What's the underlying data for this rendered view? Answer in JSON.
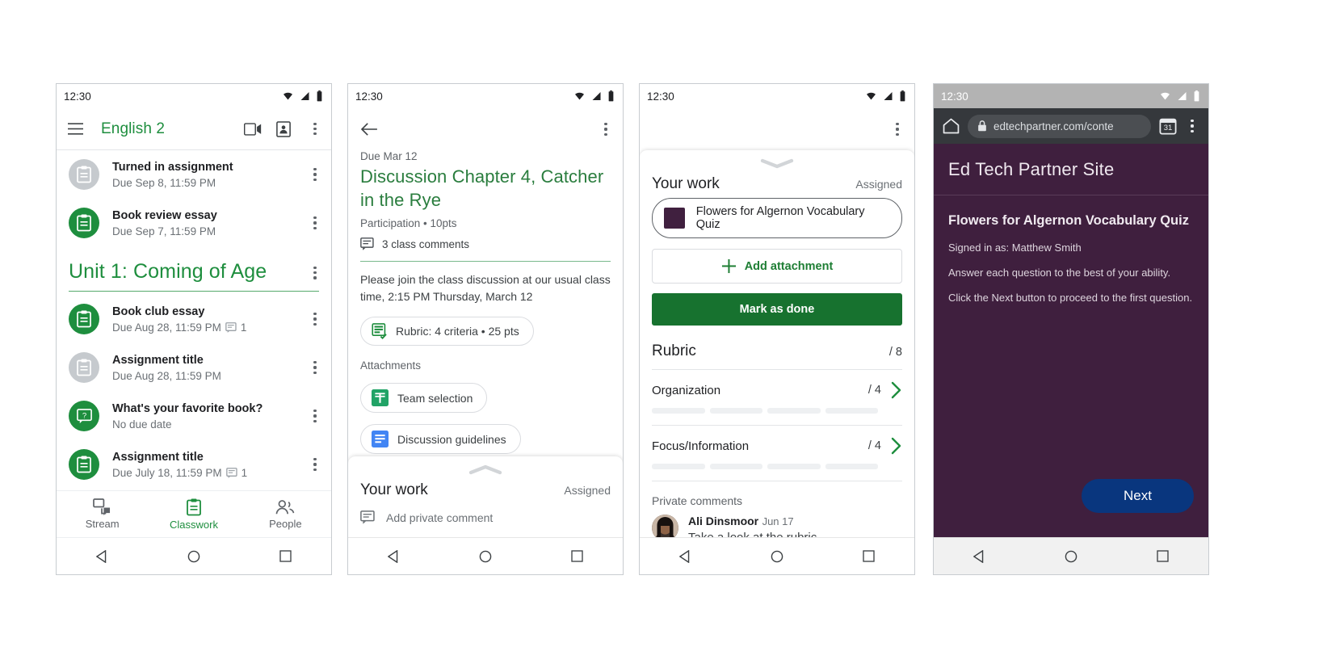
{
  "screen1": {
    "statusbar": {
      "clock": "12:30",
      "icons": [
        "wifi-icon",
        "signal-icon",
        "battery-icon"
      ]
    },
    "appbar": {
      "menu_icon": "hamburger-menu-icon",
      "title": "English 2",
      "actions": [
        "video-call-icon",
        "class-card-icon",
        "overflow-menu-icon"
      ]
    },
    "top_items": [
      {
        "title": "Turned in assignment",
        "subtitle": "Due Sep 8, 11:59 PM",
        "icon": "assignment-icon",
        "state": "grey",
        "comments": ""
      },
      {
        "title": "Book review essay",
        "subtitle": "Due Sep 7, 11:59 PM",
        "icon": "assignment-icon",
        "state": "green",
        "comments": ""
      }
    ],
    "unit": {
      "title": "Unit 1: Coming of Age"
    },
    "unit_items": [
      {
        "title": "Book club essay",
        "subtitle": "Due Aug 28, 11:59 PM",
        "icon": "assignment-icon",
        "state": "green",
        "comments": "1"
      },
      {
        "title": "Assignment title",
        "subtitle": "Due Aug 28, 11:59 PM",
        "icon": "assignment-icon",
        "state": "grey",
        "comments": ""
      },
      {
        "title": "What's your favorite book?",
        "subtitle": "No due date",
        "icon": "question-icon",
        "state": "green",
        "comments": ""
      },
      {
        "title": "Assignment title",
        "subtitle": "Due July 18, 11:59 PM",
        "icon": "assignment-icon",
        "state": "green",
        "comments": "1"
      }
    ],
    "tabs": [
      {
        "label": "Stream",
        "icon": "stream-icon",
        "active": false
      },
      {
        "label": "Classwork",
        "icon": "classwork-icon",
        "active": true
      },
      {
        "label": "People",
        "icon": "people-icon",
        "active": false
      }
    ]
  },
  "screen2": {
    "statusbar": {
      "clock": "12:30"
    },
    "back_icon": "back-arrow-icon",
    "overflow_icon": "overflow-menu-icon",
    "due": "Due Mar 12",
    "title": "Discussion Chapter 4, Catcher in the Rye",
    "meta": "Participation • 10pts",
    "class_comments": "3 class comments",
    "description": "Please join the class discussion at our usual class time, 2:15 PM Thursday, March 12",
    "rubric_chip": "Rubric: 4 criteria • 25 pts",
    "attachments_label": "Attachments",
    "attachments": [
      {
        "label": "Team selection",
        "icon": "google-sheets-icon"
      },
      {
        "label": "Discussion guidelines",
        "icon": "google-docs-icon"
      }
    ],
    "sheet": {
      "heading": "Your work",
      "status": "Assigned",
      "private_comment_placeholder": "Add private comment",
      "comment_icon": "comment-icon"
    }
  },
  "screen3": {
    "statusbar": {
      "clock": "12:30"
    },
    "overflow_icon": "overflow-menu-icon",
    "sheet": {
      "heading": "Your work",
      "status": "Assigned",
      "attachment": {
        "label": "Flowers for Algernon Vocabulary Quiz",
        "thumb_color": "#40203f"
      },
      "add_attachment": "Add attachment",
      "mark_done": "Mark as done"
    },
    "rubric": {
      "heading": "Rubric",
      "total": "/ 8",
      "criteria": [
        {
          "name": "Organization",
          "score": "/ 4",
          "bars": 4
        },
        {
          "name": "Focus/Information",
          "score": "/ 4",
          "bars": 4
        }
      ]
    },
    "private_comments": {
      "label": "Private comments",
      "items": [
        {
          "author": "Ali Dinsmoor",
          "date": "Jun 17",
          "body": "Take a look at the rubric."
        }
      ]
    }
  },
  "screen4": {
    "statusbar": {
      "clock": "12:30"
    },
    "browser": {
      "home_icon": "home-icon",
      "lock_icon": "lock-icon",
      "url": "edtechpartner.com/conte",
      "tabs_icon": "tab-count-icon",
      "tabs_count": "31",
      "overflow_icon": "overflow-menu-icon"
    },
    "page": {
      "site_title": "Ed Tech Partner Site",
      "quiz_title": "Flowers for Algernon Vocabulary Quiz",
      "lines": [
        "Signed in as: Matthew Smith",
        "Answer each question to the best of your ability.",
        "Click the Next button to proceed to the first question."
      ],
      "next_button": "Next",
      "bg_color": "#3f1f3e",
      "button_color": "#09367e"
    }
  },
  "nav": {
    "back": "nav-back-icon",
    "home": "nav-home-icon",
    "recents": "nav-recents-icon"
  }
}
